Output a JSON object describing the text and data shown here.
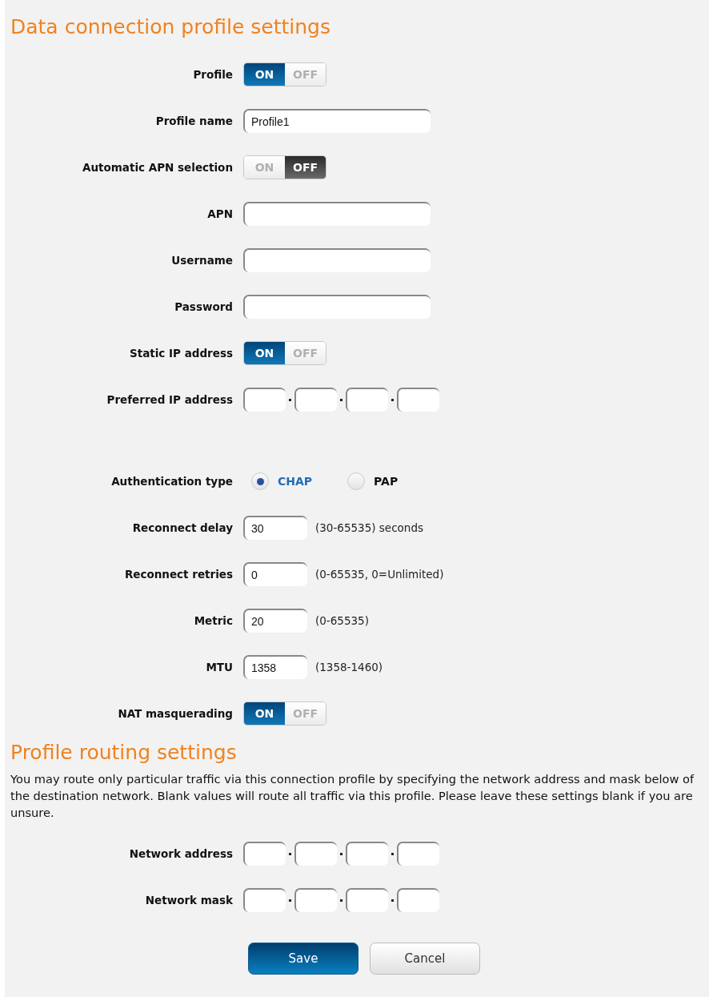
{
  "sections": [
    {
      "title": "Data connection profile settings",
      "fields": [
        {
          "kind": "toggle",
          "label": "Profile",
          "on_label": "ON",
          "off_label": "OFF",
          "on": true
        },
        {
          "kind": "text",
          "label": "Profile name",
          "value": "Profile1"
        },
        {
          "kind": "toggle",
          "label": "Automatic APN selection",
          "on_label": "ON",
          "off_label": "OFF",
          "on": false
        },
        {
          "kind": "text",
          "label": "APN"
        },
        {
          "kind": "text",
          "label": "Username"
        },
        {
          "kind": "text",
          "label": "Password"
        },
        {
          "kind": "toggle",
          "label": "Static IP address",
          "on_label": "ON",
          "off_label": "OFF",
          "on": true
        },
        {
          "kind": "ip",
          "label": "Preferred IP address"
        },
        {
          "kind": "radio",
          "label": "Authentication type",
          "options": [
            {
              "label": "CHAP",
              "selected": true
            },
            {
              "label": "PAP",
              "selected": false
            }
          ]
        },
        {
          "kind": "number",
          "label": "Reconnect delay",
          "value": "30",
          "hint": "(30-65535) seconds"
        },
        {
          "kind": "number",
          "label": "Reconnect retries",
          "value": "0",
          "hint": "(0-65535, 0=Unlimited)"
        },
        {
          "kind": "number",
          "label": "Metric",
          "value": "20",
          "hint": "(0-65535)"
        },
        {
          "kind": "number",
          "label": "MTU",
          "value": "1358",
          "hint": "(1358-1460)"
        },
        {
          "kind": "toggle",
          "label": "NAT masquerading",
          "on_label": "ON",
          "off_label": "OFF",
          "on": true
        }
      ]
    },
    {
      "title": "Profile routing settings",
      "description": "You may route only particular traffic via this connection profile by specifying the network address and mask below of the destination network. Blank values will route all traffic via this profile. Please leave these settings blank if you are unsure.",
      "fields": [
        {
          "kind": "ip",
          "label": "Network address"
        },
        {
          "kind": "ip",
          "label": "Network mask"
        }
      ]
    }
  ],
  "buttons": [
    {
      "label": "Save",
      "primary": true
    },
    {
      "label": "Cancel",
      "primary": false
    }
  ]
}
